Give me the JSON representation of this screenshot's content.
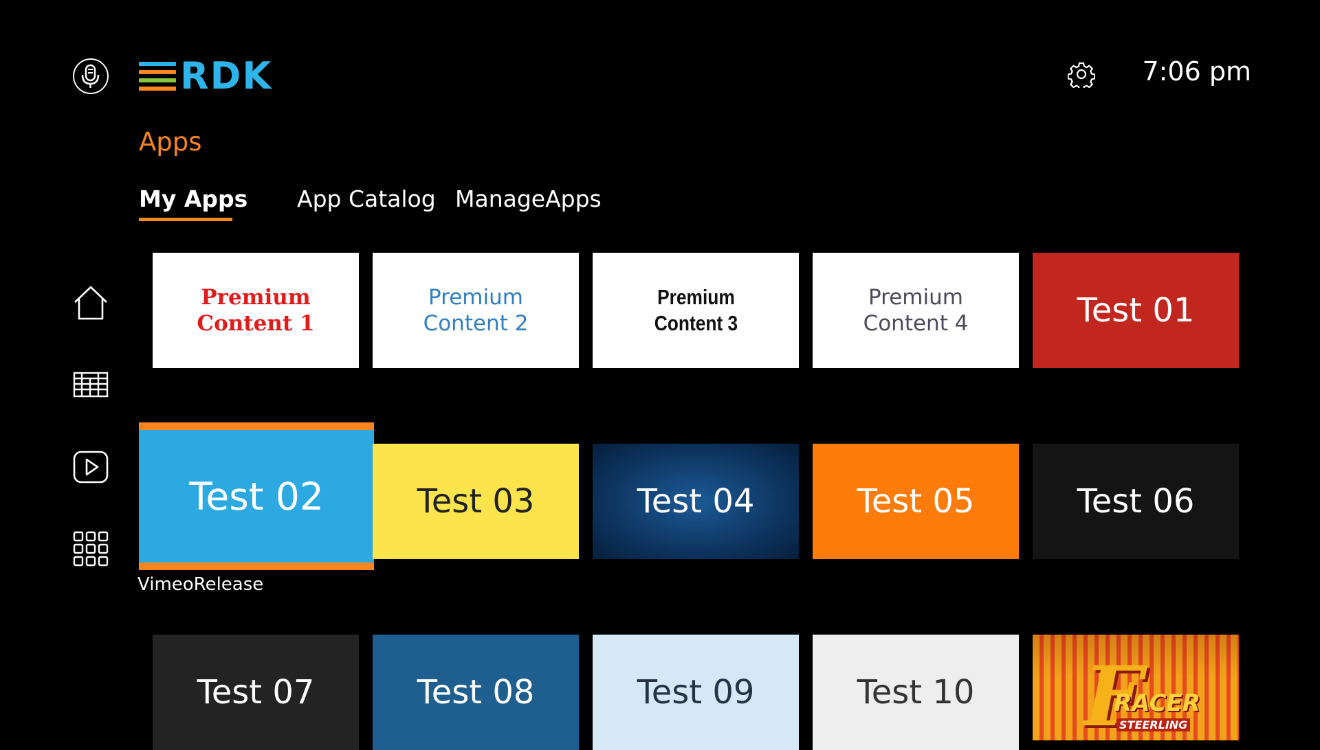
{
  "header": {
    "logo_text": "RDK",
    "logo_bar_colors": [
      "#2eb4e8",
      "#f7861e",
      "#8bc53f",
      "#f7861e"
    ],
    "clock": "7:06 pm",
    "icons": {
      "voice": "microphone-icon",
      "settings": "gear-icon"
    }
  },
  "section_title": "Apps",
  "tabs": [
    {
      "label": "My Apps",
      "selected": true
    },
    {
      "label": "App Catalog",
      "selected": false
    },
    {
      "label": "ManageApps",
      "selected": false
    }
  ],
  "sidebar": [
    {
      "icon": "home-icon"
    },
    {
      "icon": "guide-grid-icon"
    },
    {
      "icon": "play-icon"
    },
    {
      "icon": "apps-grid-icon"
    }
  ],
  "accent_color": "#f7861e",
  "focused_caption": "VimeoRelease",
  "tiles": [
    {
      "label": "Premium\nContent 1",
      "bg": "#ffffff",
      "fg": "#e01b1b"
    },
    {
      "label": "Premium\nContent 2",
      "bg": "#ffffff",
      "fg": "#2f7fc1"
    },
    {
      "label": "Premium\nContent 3",
      "bg": "#ffffff",
      "fg": "#111111"
    },
    {
      "label": "Premium\nContent 4",
      "bg": "#ffffff",
      "fg": "#4a4a5a"
    },
    {
      "label": "Test 01",
      "bg": "#c1271f",
      "fg": "#ffffff"
    },
    {
      "label": "Test 02",
      "bg": "#2ca9e1",
      "fg": "#ffffff"
    },
    {
      "label": "Test 03",
      "bg": "#fbe44c",
      "fg": "#222222"
    },
    {
      "label": "Test 04",
      "bg": "#0d3c6c",
      "fg": "#ffffff"
    },
    {
      "label": "Test 05",
      "bg": "#fb7c0b",
      "fg": "#ffffff"
    },
    {
      "label": "Test 06",
      "bg": "#141414",
      "fg": "#ffffff"
    },
    {
      "label": "Test 07",
      "bg": "#232323",
      "fg": "#ffffff"
    },
    {
      "label": "Test 08",
      "bg": "#1e5f8f",
      "fg": "#ffffff"
    },
    {
      "label": "Test 09",
      "bg": "#d5e8f6",
      "fg": "#243444"
    },
    {
      "label": "Test 10",
      "bg": "#eeeeee",
      "fg": "#333333"
    },
    {
      "label": "RACER",
      "logo_letter": "F",
      "tagline": "STEERLING",
      "bg": "#e64b1c",
      "fg": "#ffd23c"
    }
  ]
}
